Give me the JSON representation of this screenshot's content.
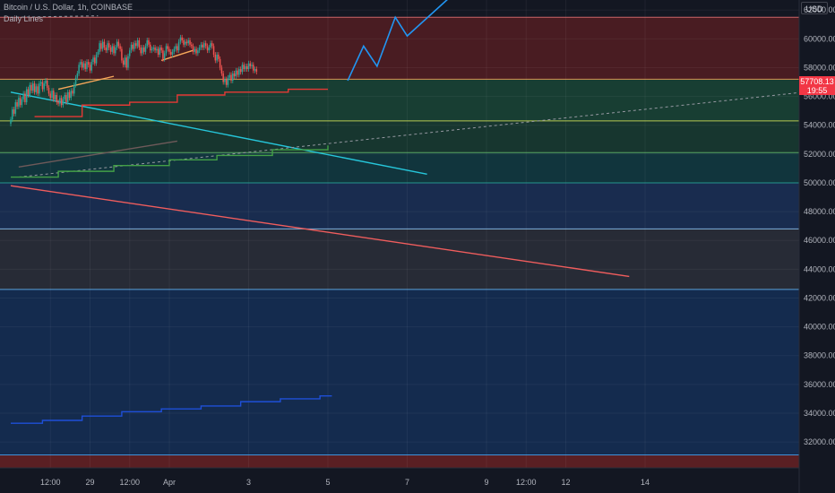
{
  "header": {
    "title": "Bitcoin / U.S. Dollar, 1h, COINBASE",
    "indicator": "Daily Lines",
    "currency": "USD"
  },
  "price_tag": {
    "price": "57708.13",
    "countdown": "19:55"
  },
  "colors": {
    "background": "#131722",
    "candle_up": "#26a69a",
    "candle_down": "#ef5350",
    "forecast": "#2196f3",
    "trend_cyan": "#26c6da",
    "trend_red": "#f05d5d",
    "zone_red": "#8b2424",
    "zone_green": "#1d5e41",
    "zone_teal": "#114a50",
    "zone_blue": "#1e3b6e",
    "zone_gray": "#2a2e39",
    "zone_navy": "#16335e"
  },
  "chart_data": {
    "type": "candlestick",
    "ylim": [
      30200,
      62700
    ],
    "y_ticks": [
      32000,
      34000,
      36000,
      38000,
      40000,
      42000,
      44000,
      46000,
      48000,
      50000,
      52000,
      54000,
      56000,
      58000,
      60000,
      62000
    ],
    "x_ticks": [
      {
        "label": "12:00",
        "t": 0.5
      },
      {
        "label": "29",
        "t": 1.0
      },
      {
        "label": "12:00",
        "t": 1.5
      },
      {
        "label": "Apr",
        "t": 2.0
      },
      {
        "label": "3",
        "t": 3.0
      },
      {
        "label": "5",
        "t": 4.0
      },
      {
        "label": "7",
        "t": 5.0
      },
      {
        "label": "9",
        "t": 6.0
      },
      {
        "label": "12:00",
        "t": 6.5
      },
      {
        "label": "12",
        "t": 7.0
      },
      {
        "label": "14",
        "t": 8.0
      }
    ],
    "zones": [
      {
        "from": 57200,
        "to": 61500,
        "color": "#8b2424",
        "opacity": 0.45
      },
      {
        "from": 54300,
        "to": 57200,
        "color": "#1d5e41",
        "opacity": 0.55
      },
      {
        "from": 52100,
        "to": 54300,
        "color": "#1d5e41",
        "opacity": 0.45
      },
      {
        "from": 50000,
        "to": 52100,
        "color": "#114a50",
        "opacity": 0.6
      },
      {
        "from": 46800,
        "to": 50000,
        "color": "#1e3b6e",
        "opacity": 0.6
      },
      {
        "from": 42600,
        "to": 46800,
        "color": "#2a2e39",
        "opacity": 0.9
      },
      {
        "from": 31100,
        "to": 42600,
        "color": "#16335e",
        "opacity": 0.75
      },
      {
        "from": 30200,
        "to": 31100,
        "color": "#8b2424",
        "opacity": 0.6
      }
    ],
    "levels": [
      {
        "y": 61500,
        "color": "#e57373"
      },
      {
        "y": 57200,
        "color": "#f7a75a"
      },
      {
        "y": 54300,
        "color": "#d4e157"
      },
      {
        "y": 52100,
        "color": "#66bb6a"
      },
      {
        "y": 50000,
        "color": "#26a69a"
      },
      {
        "y": 46800,
        "color": "#90caf9"
      },
      {
        "y": 42600,
        "color": "#64b5f6"
      },
      {
        "y": 31100,
        "color": "#42a5f5"
      }
    ],
    "candles": {
      "t_start": 0.0,
      "t_step": 0.02,
      "close": [
        54400,
        55100,
        54800,
        55600,
        55300,
        55900,
        55400,
        55800,
        56200,
        55600,
        56500,
        56100,
        56800,
        56400,
        56900,
        56300,
        56700,
        56200,
        56900,
        57000,
        56500,
        56900,
        57100,
        56600,
        56200,
        55900,
        56400,
        55800,
        56100,
        55600,
        55500,
        55900,
        55400,
        55800,
        56100,
        55600,
        56300,
        55900,
        56400,
        56200,
        56800,
        57300,
        57600,
        58200,
        58400,
        58000,
        58300,
        57900,
        58400,
        58200,
        57800,
        58400,
        58700,
        58300,
        58900,
        59100,
        59700,
        59300,
        59800,
        59400,
        59200,
        59700,
        59400,
        59100,
        59500,
        59000,
        59400,
        59800,
        59500,
        59300,
        58500,
        58200,
        58700,
        58000,
        58800,
        59200,
        59600,
        59300,
        59700,
        59500,
        59900,
        59400,
        59000,
        59400,
        59100,
        59500,
        59900,
        59600,
        59200,
        59300,
        59400,
        59200,
        59300,
        58900,
        59400,
        59200,
        58600,
        59000,
        59500,
        59300,
        59100,
        58900,
        59100,
        59300,
        59500,
        59200,
        59800,
        60100,
        59900,
        59600,
        59800,
        59700,
        59900,
        59600,
        59500,
        59100,
        59300,
        59000,
        59200,
        59400,
        59600,
        59400,
        59700,
        59500,
        59200,
        59400,
        59700,
        59500,
        58900,
        58500,
        58900,
        58600,
        58000,
        57600,
        57000,
        57200,
        56800,
        57300,
        57500,
        57100,
        57600,
        57400,
        57800,
        57500,
        57900,
        57700,
        58200,
        57900,
        58100,
        57900,
        58300,
        58100,
        58200,
        57800,
        57900,
        57708
      ]
    },
    "forecast": [
      {
        "t": 4.25,
        "y": 57100
      },
      {
        "t": 4.45,
        "y": 59500
      },
      {
        "t": 4.62,
        "y": 58100
      },
      {
        "t": 4.85,
        "y": 61500
      },
      {
        "t": 5.0,
        "y": 60200
      },
      {
        "t": 5.6,
        "y": 63200
      }
    ],
    "trendlines": [
      {
        "from": {
          "t": 0.0,
          "y": 56300
        },
        "to": {
          "t": 5.25,
          "y": 50600
        },
        "color": "#26c6da"
      },
      {
        "from": {
          "t": 0.0,
          "y": 49800
        },
        "to": {
          "t": 7.8,
          "y": 43500
        },
        "color": "#f05d5d"
      },
      {
        "from": {
          "t": 0.1,
          "y": 50400
        },
        "to": {
          "t": 10.0,
          "y": 56300
        },
        "color": "#9598a1",
        "dashed": true
      },
      {
        "from": {
          "t": 0.0,
          "y": 61500
        },
        "to": {
          "t": 1.1,
          "y": 61600
        },
        "color": "#9598a1",
        "dashed": true
      },
      {
        "from": {
          "t": 0.6,
          "y": 56500
        },
        "to": {
          "t": 1.3,
          "y": 57400
        },
        "color": "#f7a75a"
      },
      {
        "from": {
          "t": 1.9,
          "y": 58500
        },
        "to": {
          "t": 2.3,
          "y": 59200
        },
        "color": "#f7a75a"
      },
      {
        "from": {
          "t": 0.1,
          "y": 51100
        },
        "to": {
          "t": 2.1,
          "y": 52900
        },
        "color": "#6f5a5a"
      }
    ],
    "steps": [
      {
        "color": "#e53935",
        "points": [
          [
            0.3,
            54600
          ],
          [
            0.9,
            54600
          ],
          [
            0.9,
            55400
          ],
          [
            1.5,
            55400
          ],
          [
            1.5,
            55600
          ],
          [
            2.1,
            55600
          ],
          [
            2.1,
            56100
          ],
          [
            2.7,
            56100
          ],
          [
            2.7,
            56300
          ],
          [
            3.5,
            56300
          ],
          [
            3.5,
            56500
          ],
          [
            4.0,
            56500
          ]
        ]
      },
      {
        "color": "#43a047",
        "points": [
          [
            0.0,
            50400
          ],
          [
            0.6,
            50400
          ],
          [
            0.6,
            50800
          ],
          [
            1.3,
            50800
          ],
          [
            1.3,
            51200
          ],
          [
            2.0,
            51200
          ],
          [
            2.0,
            51600
          ],
          [
            2.6,
            51600
          ],
          [
            2.6,
            51900
          ],
          [
            3.3,
            51900
          ],
          [
            3.3,
            52300
          ],
          [
            4.0,
            52300
          ],
          [
            4.0,
            52600
          ]
        ]
      },
      {
        "color": "#1e4fd8",
        "points": [
          [
            0.0,
            33300
          ],
          [
            0.4,
            33300
          ],
          [
            0.4,
            33500
          ],
          [
            0.9,
            33500
          ],
          [
            0.9,
            33800
          ],
          [
            1.4,
            33800
          ],
          [
            1.4,
            34100
          ],
          [
            1.9,
            34100
          ],
          [
            1.9,
            34300
          ],
          [
            2.4,
            34300
          ],
          [
            2.4,
            34500
          ],
          [
            2.9,
            34500
          ],
          [
            2.9,
            34800
          ],
          [
            3.4,
            34800
          ],
          [
            3.4,
            35000
          ],
          [
            3.9,
            35000
          ],
          [
            3.9,
            35200
          ],
          [
            4.05,
            35200
          ]
        ]
      }
    ]
  }
}
